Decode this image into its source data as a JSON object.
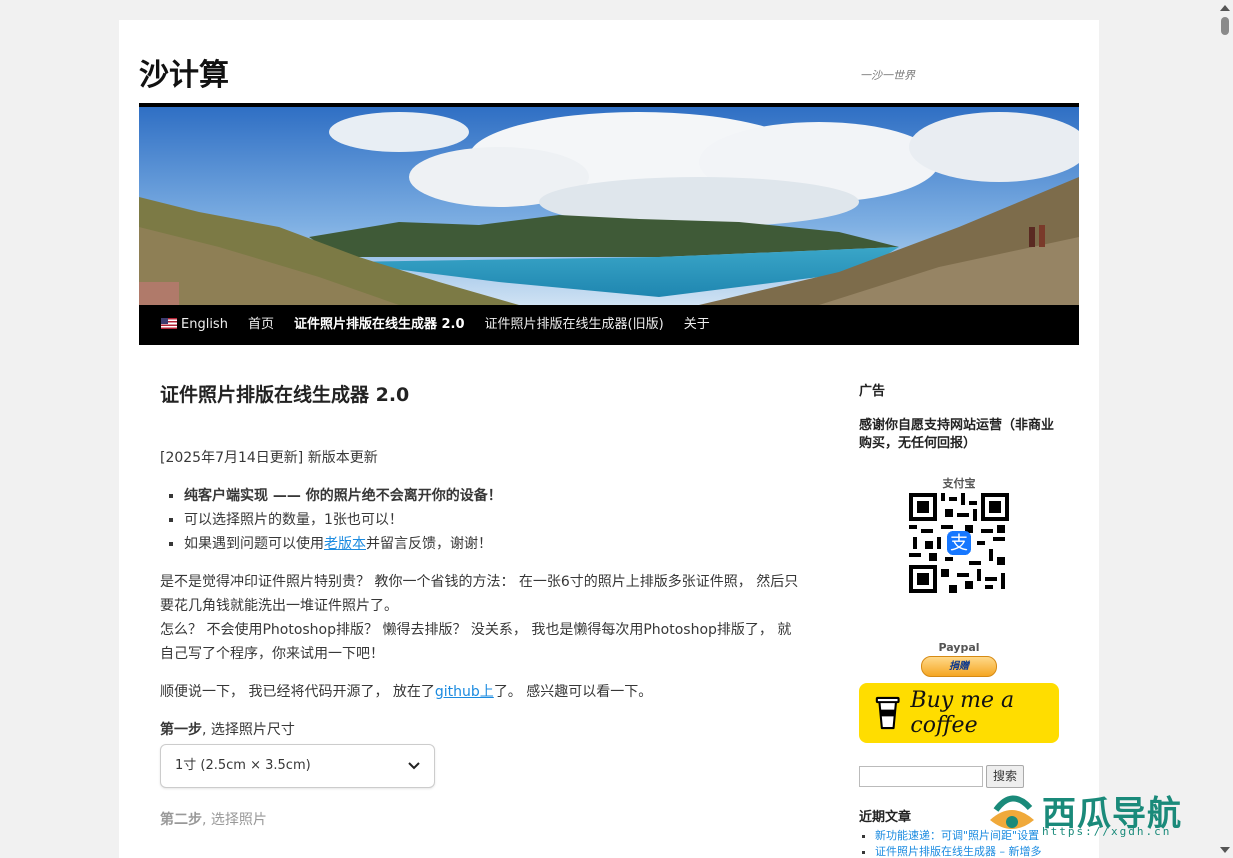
{
  "site": {
    "title": "沙计算",
    "description": "一沙一世界"
  },
  "nav": {
    "items": [
      {
        "label": "English",
        "current": false
      },
      {
        "label": "首页",
        "current": false
      },
      {
        "label": "证件照片排版在线生成器 2.0",
        "current": true
      },
      {
        "label": "证件照片排版在线生成器(旧版)",
        "current": false
      },
      {
        "label": "关于",
        "current": false
      }
    ]
  },
  "article": {
    "title": "证件照片排版在线生成器 2.0",
    "update_date": "[2025年7月14日更新]",
    "update_text": " 新版本更新",
    "features": [
      "纯客户端实现 —— 你的照片绝不会离开你的设备！",
      "可以选择照片的数量，1张也可以！"
    ],
    "feature3_before": "如果遇到问题可以使用",
    "feature3_link": "老版本",
    "feature3_after": "并留言反馈，谢谢！",
    "para1_line1": "是不是觉得冲印证件照片特别贵？ 教你一个省钱的方法： 在一张6寸的照片上排版多张证件照， 然后只要花几角钱就能洗出一堆证件照片了。",
    "para1_line2": "怎么？ 不会使用Photoshop排版？ 懒得去排版？ 没关系， 我也是懒得每次用Photoshop排版了， 就自己写了个程序，你来试用一下吧！",
    "para2_before": "顺便说一下， 我已经将代码开源了， 放在了",
    "para2_link": "github上",
    "para2_after": "了。 感兴趣可以看一下。",
    "step1_bold": "第一步",
    "step1_text": ", 选择照片尺寸",
    "size_selected": "1寸 (2.5cm × 3.5cm)",
    "step2_bold": "第二步",
    "step2_text": ", 选择照片"
  },
  "sidebar": {
    "ad_title": "广告",
    "thanks": "感谢你自愿支持网站运营（非商业购买，无任何回报）",
    "alipay_label": "支付宝",
    "paypal_label": "Paypal",
    "donate_label": "捐赠",
    "coffee_label": "Buy me a coffee",
    "search_button": "搜索",
    "recent_title": "近期文章",
    "recent": [
      "新功能速递：可调\"照片间距\"设置",
      "证件照片排版在线生成器 – 新增多"
    ]
  },
  "watermark": {
    "text": "西瓜导航",
    "url": "https://xgdh.cn"
  },
  "colors": {
    "link": "#1b8be0",
    "nav_bg": "#000000",
    "coffee_bg": "#ffdd00"
  }
}
